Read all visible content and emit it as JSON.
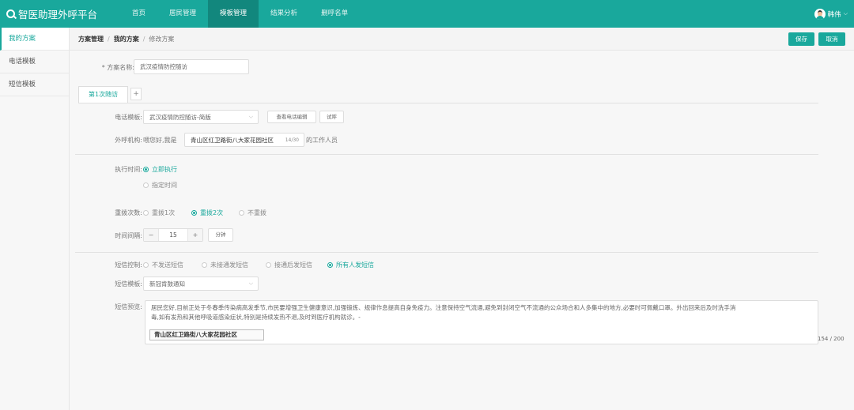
{
  "app": {
    "title": "智医助理外呼平台"
  },
  "nav": [
    {
      "label": "首页",
      "active": false
    },
    {
      "label": "居民管理",
      "active": false
    },
    {
      "label": "模板管理",
      "active": true
    },
    {
      "label": "结果分析",
      "active": false
    },
    {
      "label": "删呼名单",
      "active": false
    }
  ],
  "user": {
    "name": "韩伟"
  },
  "sidebar": [
    {
      "label": "我的方案",
      "active": true
    },
    {
      "label": "电话模板",
      "active": false
    },
    {
      "label": "短信模板",
      "active": false
    }
  ],
  "breadcrumb": {
    "level1": "方案管理",
    "level2": "我的方案",
    "current": "修改方案"
  },
  "toolbar": {
    "save_label": "保存",
    "cancel_label": "取消"
  },
  "plan": {
    "name_label": "* 方案名称:",
    "name_value": "武汉疫情防控随访"
  },
  "tabs": [
    {
      "label": "第1次随访"
    }
  ],
  "tab_add": "+",
  "phone": {
    "template_label": "电话模板:",
    "template_value": "武汉疫情防控随访-简版",
    "edit_button": "查看电话编辑",
    "trial_button": "试呼",
    "org_label": "外呼机构:",
    "org_prefix": "喂您好,我是",
    "org_value": "青山区红卫路街八大家花园社区",
    "org_count": "14/30",
    "org_suffix": "的工作人员"
  },
  "exec": {
    "label": "执行时间:",
    "options": [
      {
        "label": "立即执行",
        "checked": true
      },
      {
        "label": "指定时间",
        "checked": false
      }
    ]
  },
  "redial": {
    "label": "重拨次数:",
    "options": [
      {
        "label": "重拨1次",
        "checked": false
      },
      {
        "label": "重拨2次",
        "checked": true
      },
      {
        "label": "不重拨",
        "checked": false
      }
    ]
  },
  "interval": {
    "label": "时间间隔:",
    "value": "15",
    "minus": "−",
    "plus": "+",
    "unit": "分钟"
  },
  "sms": {
    "control_label": "短信控制:",
    "options": [
      {
        "label": "不发送短信",
        "checked": false
      },
      {
        "label": "未接通发短信",
        "checked": false
      },
      {
        "label": "接通后发短信",
        "checked": false
      },
      {
        "label": "所有人发短信",
        "checked": true
      }
    ],
    "template_label": "短信模板:",
    "template_value": "新冠肯鼓通知",
    "content_label": "短信预览:",
    "content_line1": "居民您好,目前正处于冬春季传染病高发季节,市民要增强卫生健康意识,加强锻炼、规律作息提高自身免疫力。注意保持空气流通,避免到封闭空气不流通的公众场合和人多集中的地方,必要时可佩戴口罩。外出回来后及时洗手消",
    "content_line2": "毒,如有发热和其他呼吸道感染症状,特别是持续发热不退,及时到医疗机构就诊。-",
    "signature": "青山区红卫路街八大家花园社区",
    "counter": "154 / 200"
  }
}
